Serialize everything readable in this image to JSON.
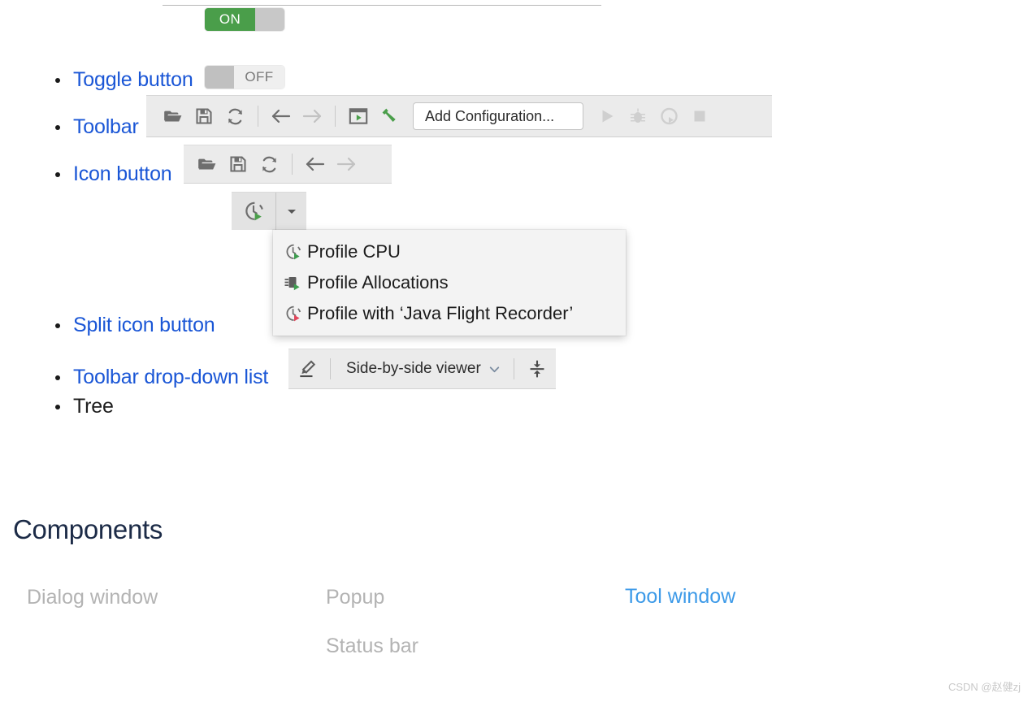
{
  "toggles": {
    "on": {
      "label": "ON",
      "state": "on"
    },
    "off": {
      "label": "OFF",
      "state": "off"
    }
  },
  "list": {
    "items": [
      {
        "label": "Toggle button",
        "link": true
      },
      {
        "label": "Toolbar",
        "link": true
      },
      {
        "label": "Icon button",
        "link": true
      },
      {
        "label": "Split icon button",
        "link": true
      },
      {
        "label": "Toolbar drop-down list",
        "link": true
      },
      {
        "label": "Tree",
        "link": false
      }
    ]
  },
  "toolbar_main": {
    "icons": [
      "open-folder-icon",
      "save-icon",
      "sync-icon",
      "back-arrow-icon",
      "forward-arrow-icon",
      "run-window-icon",
      "build-hammer-icon"
    ],
    "config_field": {
      "value": "Add Configuration...",
      "placeholder": "Add Configuration..."
    },
    "trailing_icons": [
      "run-icon",
      "debug-bug-icon",
      "profile-icon",
      "stop-icon"
    ]
  },
  "toolbar_icons": {
    "icons": [
      "open-folder-icon",
      "save-icon",
      "sync-icon",
      "back-arrow-icon",
      "forward-arrow-icon"
    ]
  },
  "split_button": {
    "main_icon": "profile-clock-run-icon",
    "arrow_icon": "chevron-down-icon"
  },
  "profile_menu": {
    "items": [
      {
        "label": "Profile CPU",
        "icon": "profile-clock-green-icon"
      },
      {
        "label": "Profile Allocations",
        "icon": "profile-allocations-green-icon"
      },
      {
        "label": "Profile with ‘Java Flight Recorder’",
        "icon": "profile-clock-red-icon"
      }
    ]
  },
  "toolbar_dropdown": {
    "edit_icon": "pencil-icon",
    "selected": "Side-by-side viewer",
    "chevron_icon": "chevron-down-icon",
    "collapse_icon": "collapse-lines-icon"
  },
  "components": {
    "heading": "Components",
    "items": [
      {
        "label": "Dialog window",
        "accent": false
      },
      {
        "label": "Popup",
        "accent": false
      },
      {
        "label": "Status bar",
        "accent": false
      },
      {
        "label": "Tool window",
        "accent": true
      }
    ]
  },
  "watermark": {
    "text": "CSDN @赵健zj"
  },
  "colors": {
    "link": "#1a56d6",
    "accent": "#3d9ae8",
    "toggle_on": "#4a9e4a",
    "heading": "#1c2b47",
    "green_icon": "#4a9e4a",
    "red_icon": "#e0465b",
    "toolbar_bg": "#ebebeb"
  }
}
